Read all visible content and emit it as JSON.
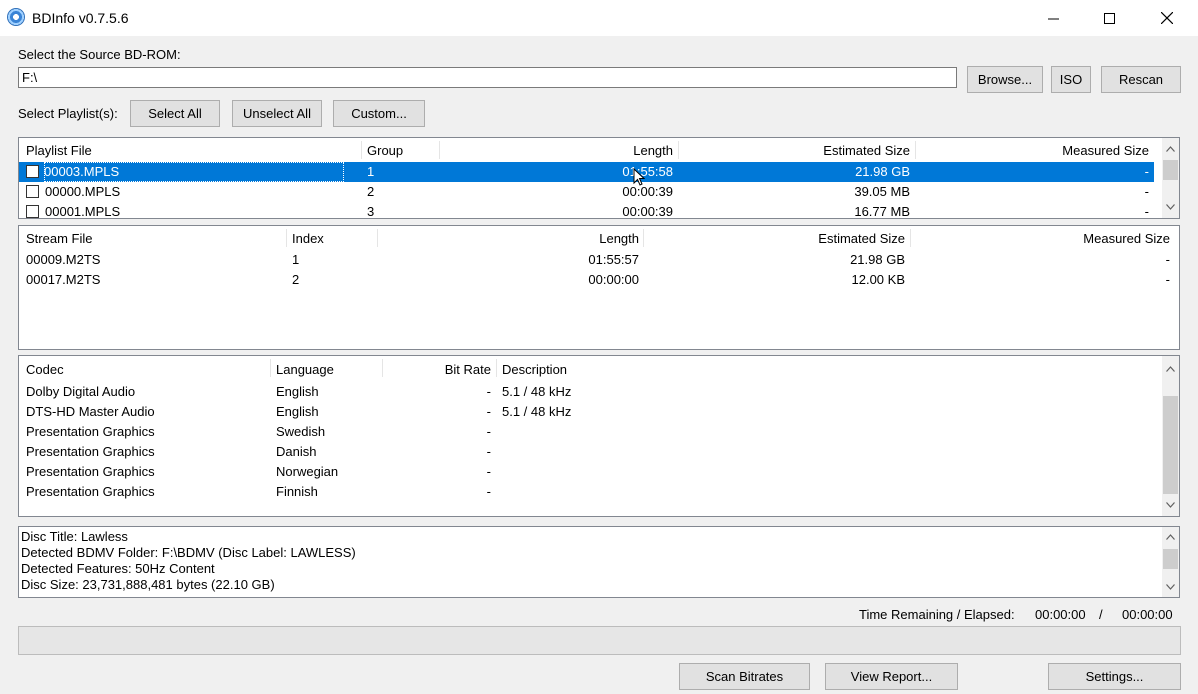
{
  "window": {
    "title": "BDInfo v0.7.5.6",
    "minimize_glyph": "—",
    "maximize_glyph": "☐",
    "close_glyph": "✕"
  },
  "source": {
    "label": "Select the Source BD-ROM:",
    "path": "F:\\",
    "browse_label": "Browse...",
    "iso_label": "ISO",
    "rescan_label": "Rescan"
  },
  "playlist_select": {
    "label": "Select Playlist(s):",
    "select_all_label": "Select All",
    "unselect_all_label": "Unselect All",
    "custom_label": "Custom..."
  },
  "playlists": {
    "headers": [
      "Playlist File",
      "Group",
      "Length",
      "Estimated Size",
      "Measured Size"
    ],
    "rows": [
      {
        "file": "00003.MPLS",
        "group": "1",
        "length": "01:55:58",
        "estimated": "21.98 GB",
        "measured": "-",
        "selected": true,
        "checked": false
      },
      {
        "file": "00000.MPLS",
        "group": "2",
        "length": "00:00:39",
        "estimated": "39.05 MB",
        "measured": "-",
        "selected": false,
        "checked": false
      },
      {
        "file": "00001.MPLS",
        "group": "3",
        "length": "00:00:39",
        "estimated": "16.77 MB",
        "measured": "-",
        "selected": false,
        "checked": false
      }
    ]
  },
  "streams": {
    "headers": [
      "Stream File",
      "Index",
      "Length",
      "Estimated Size",
      "Measured Size"
    ],
    "rows": [
      {
        "file": "00009.M2TS",
        "index": "1",
        "length": "01:55:57",
        "estimated": "21.98 GB",
        "measured": "-"
      },
      {
        "file": "00017.M2TS",
        "index": "2",
        "length": "00:00:00",
        "estimated": "12.00 KB",
        "measured": "-"
      }
    ]
  },
  "codecs": {
    "headers": [
      "Codec",
      "Language",
      "Bit Rate",
      "Description"
    ],
    "rows": [
      {
        "codec": "Dolby Digital Audio",
        "language": "English",
        "bitrate": "-",
        "description": "5.1 / 48 kHz"
      },
      {
        "codec": "DTS-HD Master Audio",
        "language": "English",
        "bitrate": "-",
        "description": "5.1 / 48 kHz"
      },
      {
        "codec": "Presentation Graphics",
        "language": "Swedish",
        "bitrate": "-",
        "description": ""
      },
      {
        "codec": "Presentation Graphics",
        "language": "Danish",
        "bitrate": "-",
        "description": ""
      },
      {
        "codec": "Presentation Graphics",
        "language": "Norwegian",
        "bitrate": "-",
        "description": ""
      },
      {
        "codec": "Presentation Graphics",
        "language": "Finnish",
        "bitrate": "-",
        "description": ""
      }
    ]
  },
  "info": {
    "lines": [
      "Disc Title: Lawless",
      "Detected BDMV Folder: F:\\BDMV (Disc Label: LAWLESS)",
      "Detected Features: 50Hz Content",
      "Disc Size: 23,731,888,481 bytes (22.10 GB)"
    ]
  },
  "status": {
    "time_label": "Time Remaining / Elapsed:",
    "remaining": "00:00:00",
    "separator": "/",
    "elapsed": "00:00:00",
    "progress": 0
  },
  "footer": {
    "scan_label": "Scan Bitrates",
    "view_report_label": "View Report...",
    "settings_label": "Settings..."
  },
  "icons": {
    "up": "⌃",
    "down": "⌄"
  }
}
